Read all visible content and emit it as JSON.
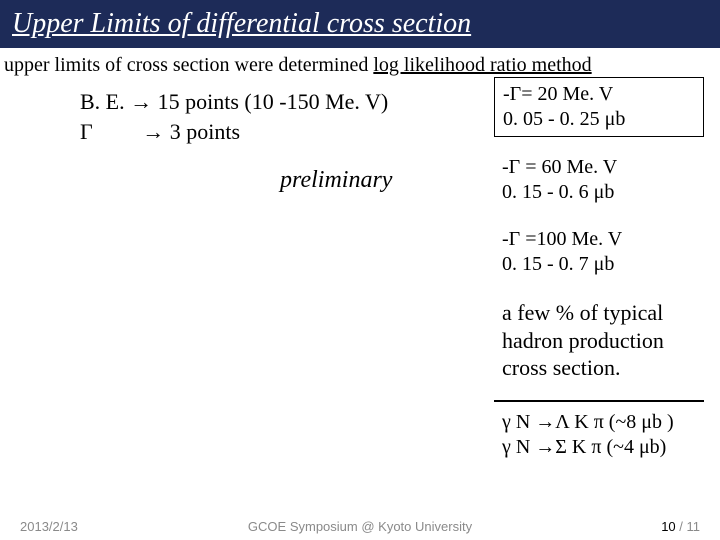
{
  "title": "Upper Limits of differential cross section",
  "subhead_plain": "upper limits of cross section were determined ",
  "subhead_underlined": "log likelihood ratio method",
  "left": {
    "row1_label": "B. E.",
    "row1_arrow": "→",
    "row1_rest": "15 points (10 -150 Me. V)",
    "row2_label": "Γ",
    "row2_arrow": "        →",
    "row2_rest": "3 points"
  },
  "preliminary": "preliminary",
  "right": {
    "box_l1": "-Γ= 20 Me. V",
    "box_l2": " 0. 05 - 0. 25 μb",
    "r2_l1": "-Γ = 60 Me. V",
    "r2_l2": " 0. 15 - 0. 6 μb",
    "r3_l1": "-Γ =100 Me. V",
    "r3_l2": " 0. 15 - 0. 7 μb",
    "typical": "a few % of typical hadron production cross section.",
    "reac1": "γ N →Λ K π (~8 μb )",
    "reac2": "γ N →Σ K π (~4 μb)"
  },
  "footer": {
    "date": "2013/2/13",
    "venue": "GCOE Symposium @ Kyoto University",
    "page_current": "10",
    "page_sep": " / ",
    "page_total": "11"
  }
}
